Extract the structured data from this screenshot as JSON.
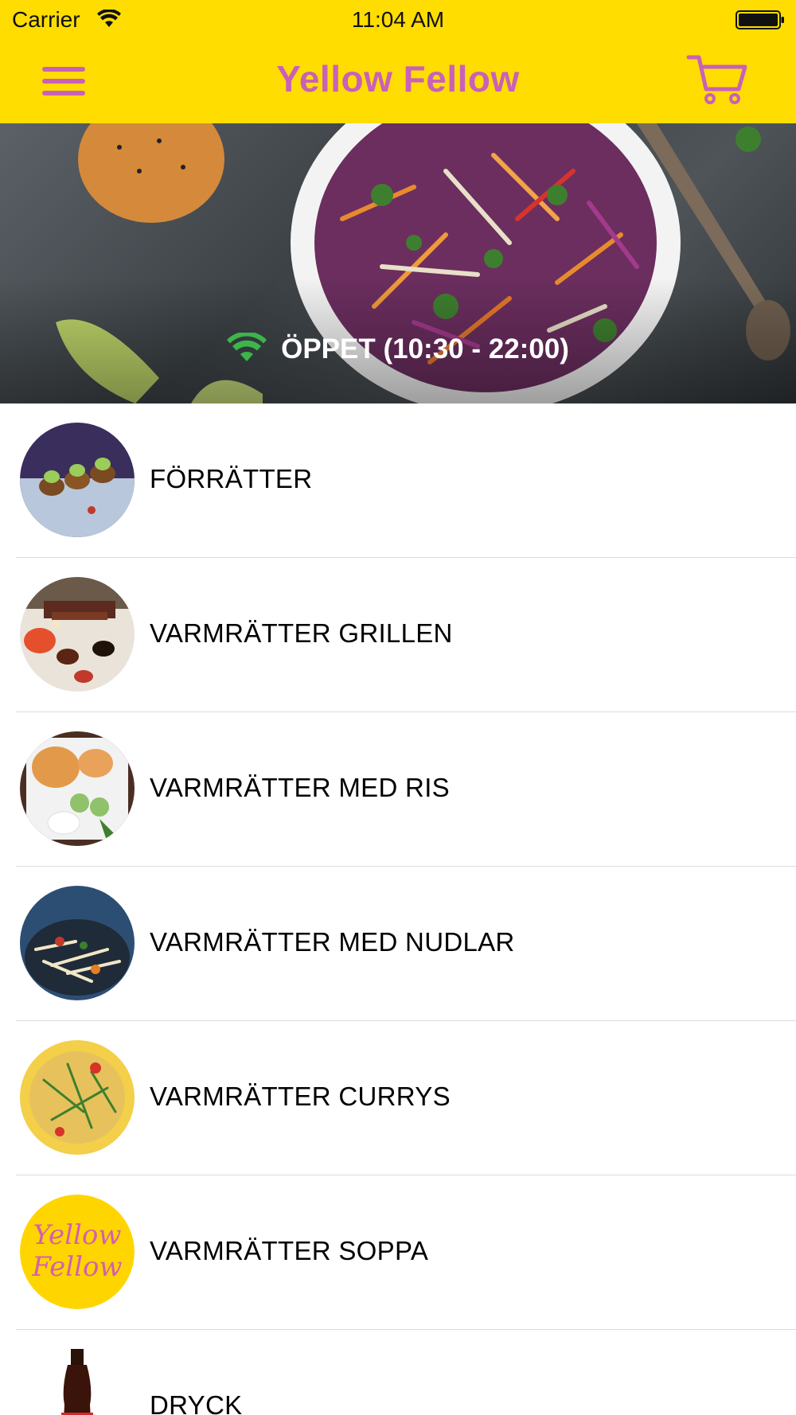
{
  "status_bar": {
    "carrier": "Carrier",
    "time": "11:04 AM"
  },
  "nav": {
    "title": "Yellow Fellow",
    "menu_icon": "hamburger-menu-icon",
    "cart_icon": "shopping-cart-icon"
  },
  "hero": {
    "open_status": "ÖPPET (10:30 - 22:00)",
    "status_icon": "wifi-signal-icon",
    "status_icon_color": "#3DB54A"
  },
  "menu": {
    "items": [
      {
        "label": "FÖRRÄTTER",
        "image": "spring-rolls"
      },
      {
        "label": "VARMRÄTTER GRILLEN",
        "image": "grill-skewers"
      },
      {
        "label": "VARMRÄTTER MED RIS",
        "image": "rice-plate"
      },
      {
        "label": "VARMRÄTTER MED NUDLAR",
        "image": "noodles"
      },
      {
        "label": "VARMRÄTTER CURRYS",
        "image": "curry"
      },
      {
        "label": "VARMRÄTTER SOPPA",
        "image": "yellow-fellow-logo",
        "logo_text": [
          "Yellow",
          "Fellow"
        ]
      },
      {
        "label": "DRYCK",
        "image": "cola-bottle"
      }
    ]
  },
  "colors": {
    "brand_yellow": "#FFDD00",
    "brand_pink": "#C961B8",
    "divider": "#DCDCDC"
  }
}
